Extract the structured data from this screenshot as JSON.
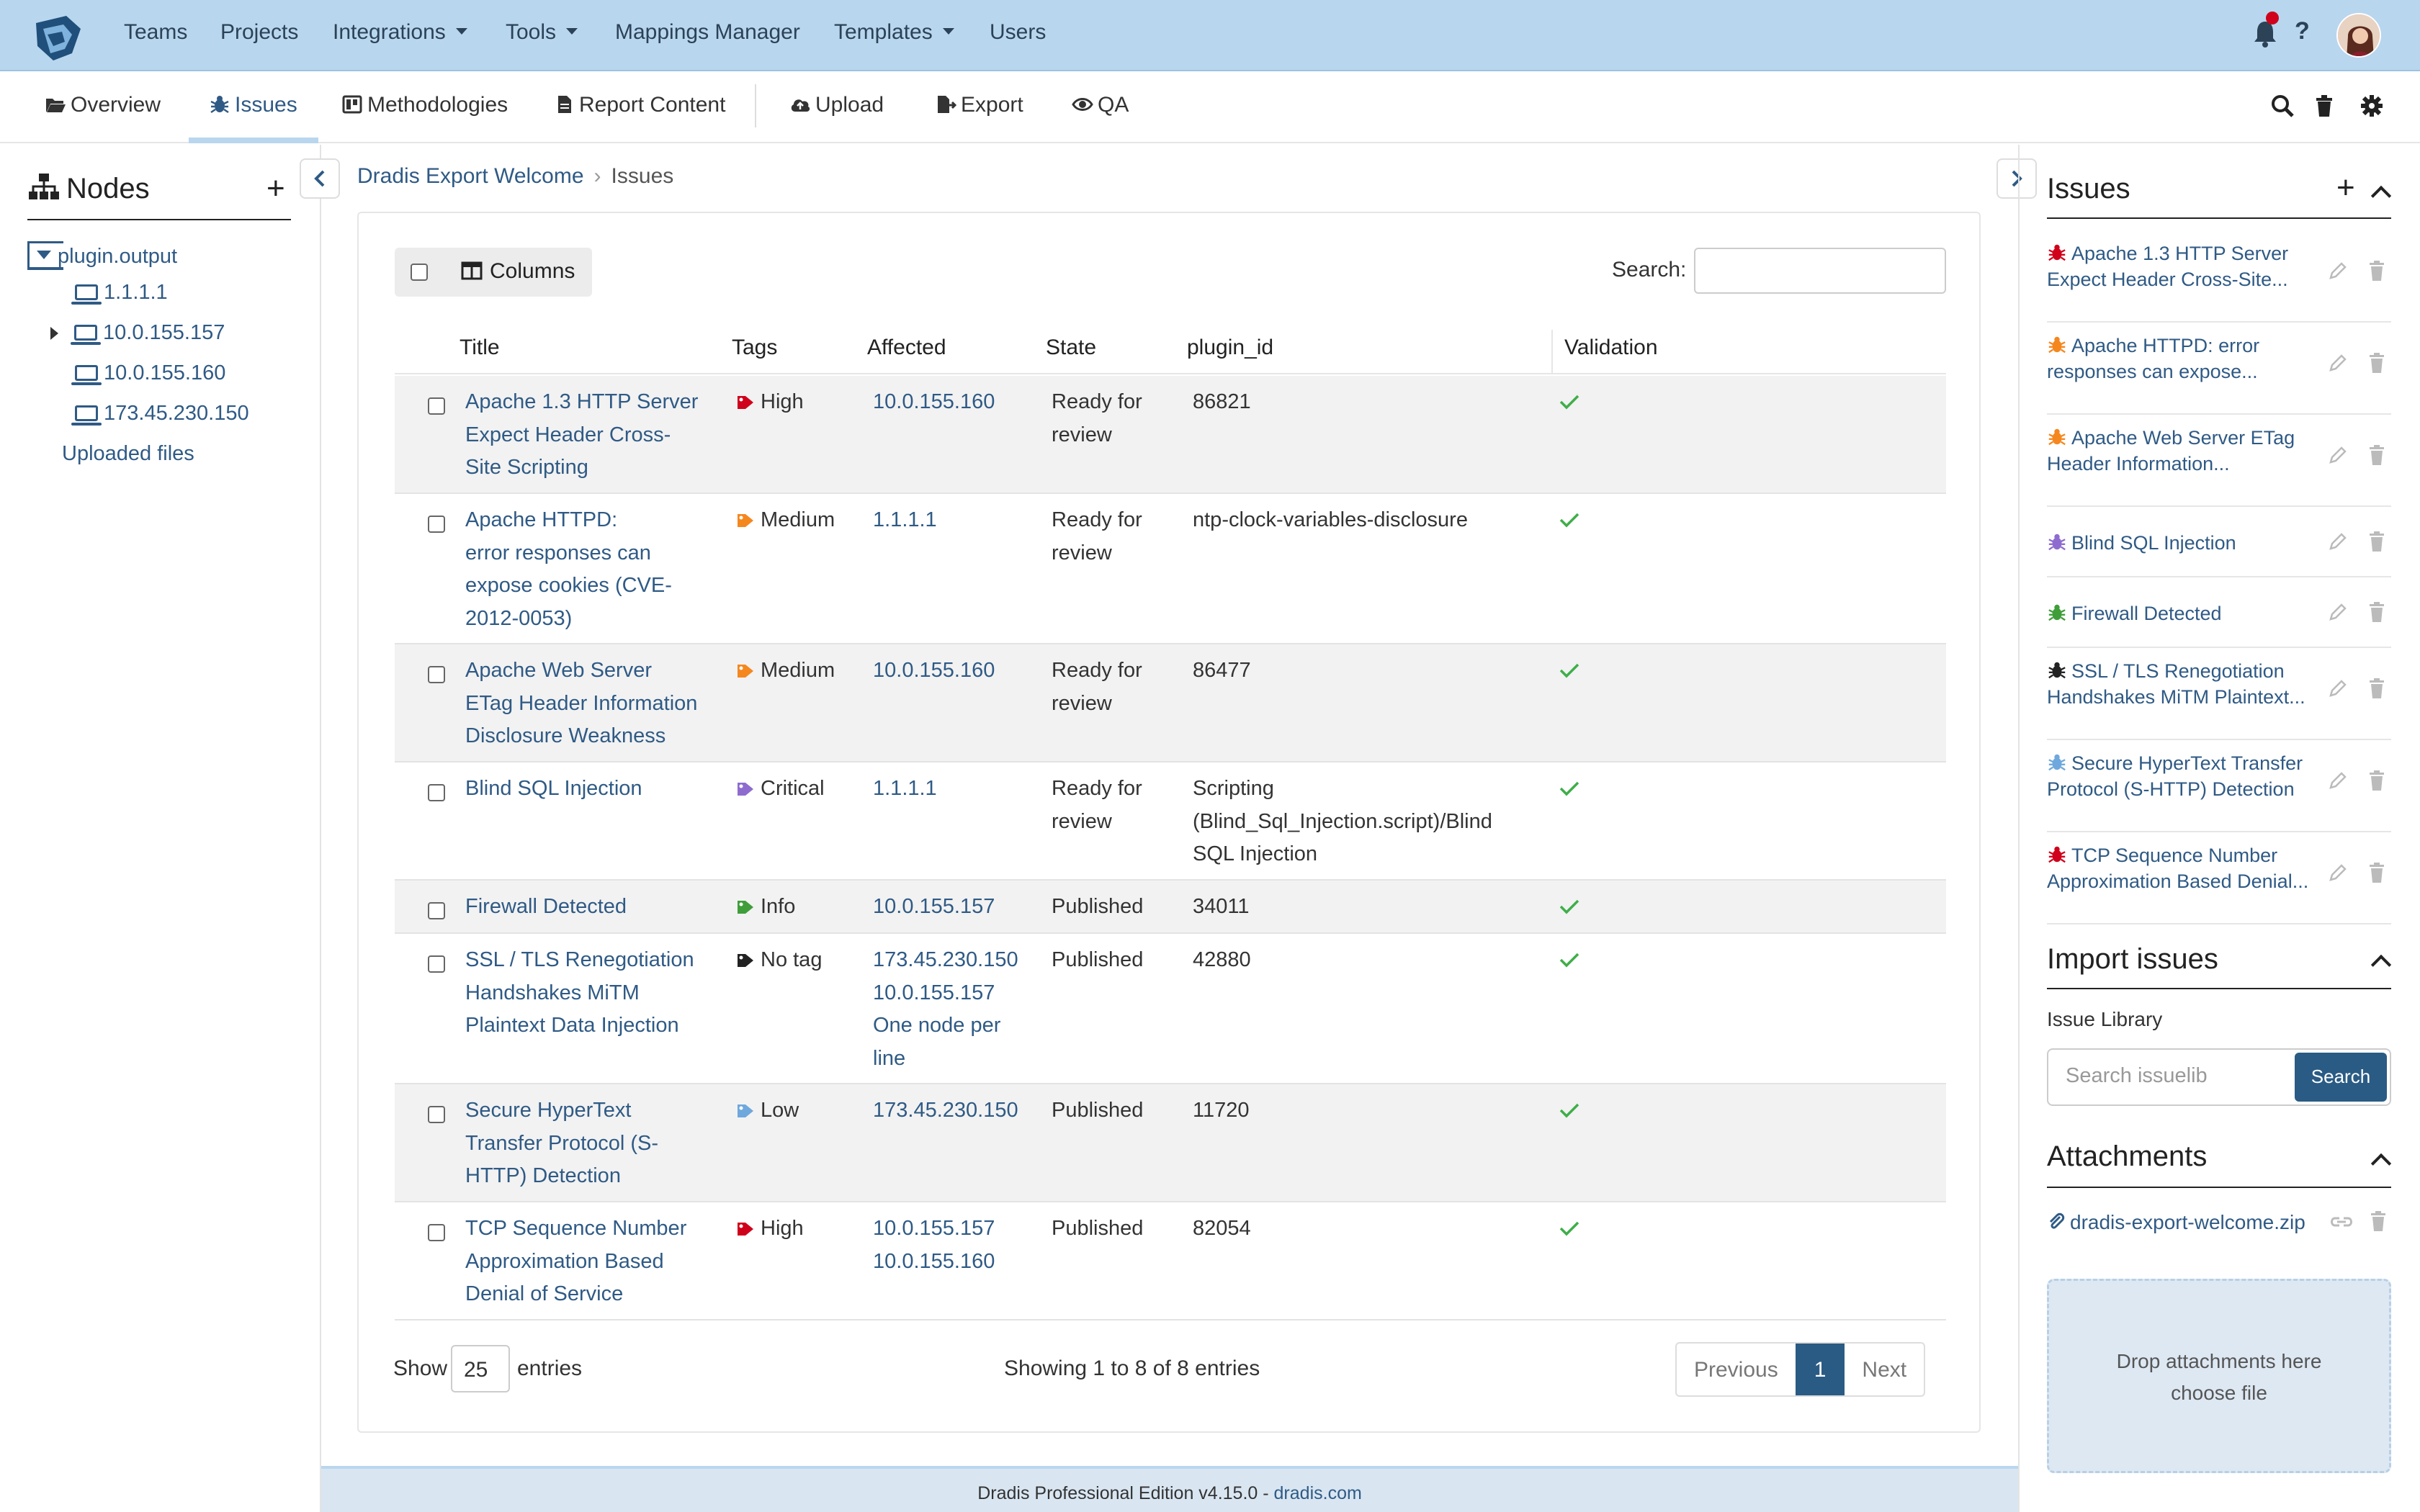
{
  "topnav": {
    "items": [
      "Teams",
      "Projects",
      "Integrations",
      "Tools",
      "Mappings Manager",
      "Templates",
      "Users"
    ],
    "help": "?"
  },
  "subnav": {
    "items": [
      "Overview",
      "Issues",
      "Methodologies",
      "Report Content",
      "Upload",
      "Export",
      "QA"
    ],
    "active": "Issues"
  },
  "nodes": {
    "title": "Nodes",
    "root": "plugin.output",
    "children": [
      "1.1.1.1",
      "10.0.155.157",
      "10.0.155.160",
      "173.45.230.150"
    ],
    "uploaded": "Uploaded files"
  },
  "breadcrumb": {
    "project": "Dradis Export Welcome",
    "current": "Issues"
  },
  "table": {
    "columns_button": "Columns",
    "search_label": "Search:",
    "headers": [
      "Title",
      "Tags",
      "Affected",
      "State",
      "plugin_id",
      "Validation"
    ],
    "rows": [
      {
        "title": [
          "Apache 1.3 HTTP Server",
          "Expect Header Cross-",
          "Site Scripting"
        ],
        "tag": "High",
        "tag_color": "#d0021b",
        "affected": [
          "10.0.155.160"
        ],
        "state": [
          "Ready for",
          "review"
        ],
        "plugin_id": [
          "86821"
        ]
      },
      {
        "title": [
          "Apache HTTPD:",
          "error responses can",
          "expose cookies (CVE-",
          "2012-0053)"
        ],
        "tag": "Medium",
        "tag_color": "#f5871f",
        "affected": [
          "1.1.1.1"
        ],
        "state": [
          "Ready for",
          "review"
        ],
        "plugin_id": [
          "ntp-clock-variables-disclosure"
        ]
      },
      {
        "title": [
          "Apache Web Server",
          "ETag Header Information",
          "Disclosure Weakness"
        ],
        "tag": "Medium",
        "tag_color": "#f5871f",
        "affected": [
          "10.0.155.160"
        ],
        "state": [
          "Ready for",
          "review"
        ],
        "plugin_id": [
          "86477"
        ]
      },
      {
        "title": [
          "Blind SQL Injection"
        ],
        "tag": "Critical",
        "tag_color": "#8e6ccf",
        "affected": [
          "1.1.1.1"
        ],
        "state": [
          "Ready for",
          "review"
        ],
        "plugin_id": [
          "Scripting",
          "(Blind_Sql_Injection.script)/Blind",
          "SQL Injection"
        ]
      },
      {
        "title": [
          "Firewall Detected"
        ],
        "tag": "Info",
        "tag_color": "#3f9e3a",
        "affected": [
          "10.0.155.157"
        ],
        "state": [
          "Published"
        ],
        "plugin_id": [
          "34011"
        ]
      },
      {
        "title": [
          "SSL / TLS Renegotiation",
          "Handshakes MiTM",
          "Plaintext Data Injection"
        ],
        "tag": "No tag",
        "tag_color": "#222222",
        "affected": [
          "173.45.230.150",
          "10.0.155.157",
          "One node per",
          "line"
        ],
        "state": [
          "Published"
        ],
        "plugin_id": [
          "42880"
        ]
      },
      {
        "title": [
          "Secure HyperText",
          "Transfer Protocol (S-",
          "HTTP) Detection"
        ],
        "tag": "Low",
        "tag_color": "#6fa8dc",
        "affected": [
          "173.45.230.150"
        ],
        "state": [
          "Published"
        ],
        "plugin_id": [
          "11720"
        ]
      },
      {
        "title": [
          "TCP Sequence Number",
          "Approximation Based",
          "Denial of Service"
        ],
        "tag": "High",
        "tag_color": "#d0021b",
        "affected": [
          "10.0.155.157",
          "10.0.155.160"
        ],
        "state": [
          "Published"
        ],
        "plugin_id": [
          "82054"
        ]
      }
    ],
    "show_label": "Show",
    "page_size": "25",
    "entries_label": "entries",
    "showing": "Showing 1 to 8 of 8 entries",
    "pager": {
      "prev": "Previous",
      "current": "1",
      "next": "Next"
    }
  },
  "sidebar": {
    "issues_title": "Issues",
    "issues": [
      {
        "label": [
          "Apache 1.3 HTTP Server",
          "Expect Header Cross-Site..."
        ],
        "color": "#d0021b"
      },
      {
        "label": [
          "Apache HTTPD: error",
          "responses can expose..."
        ],
        "color": "#f5871f"
      },
      {
        "label": [
          "Apache Web Server ETag",
          "Header Information..."
        ],
        "color": "#f5871f"
      },
      {
        "label": [
          "Blind SQL Injection"
        ],
        "color": "#8e6ccf"
      },
      {
        "label": [
          "Firewall Detected"
        ],
        "color": "#3f9e3a"
      },
      {
        "label": [
          "SSL / TLS Renegotiation",
          "Handshakes MiTM Plaintext..."
        ],
        "color": "#222222"
      },
      {
        "label": [
          "Secure HyperText Transfer",
          "Protocol (S-HTTP) Detection"
        ],
        "color": "#6fa8dc"
      },
      {
        "label": [
          "TCP Sequence Number",
          "Approximation Based Denial..."
        ],
        "color": "#d0021b"
      }
    ],
    "import_title": "Import issues",
    "issue_library_label": "Issue Library",
    "issuelib_placeholder": "Search issuelib",
    "issuelib_button": "Search",
    "attachments_title": "Attachments",
    "attachment_file": "dradis-export-welcome.zip",
    "dropzone_line1": "Drop attachments here",
    "dropzone_line2": "choose file"
  },
  "footer": {
    "text": "Dradis Professional Edition v4.15.0 - ",
    "link": "dradis.com"
  },
  "colors": {
    "topbar": "#b9d6ef",
    "primary": "#2a5b84",
    "link": "#2f5a85",
    "check": "#3fae49"
  }
}
